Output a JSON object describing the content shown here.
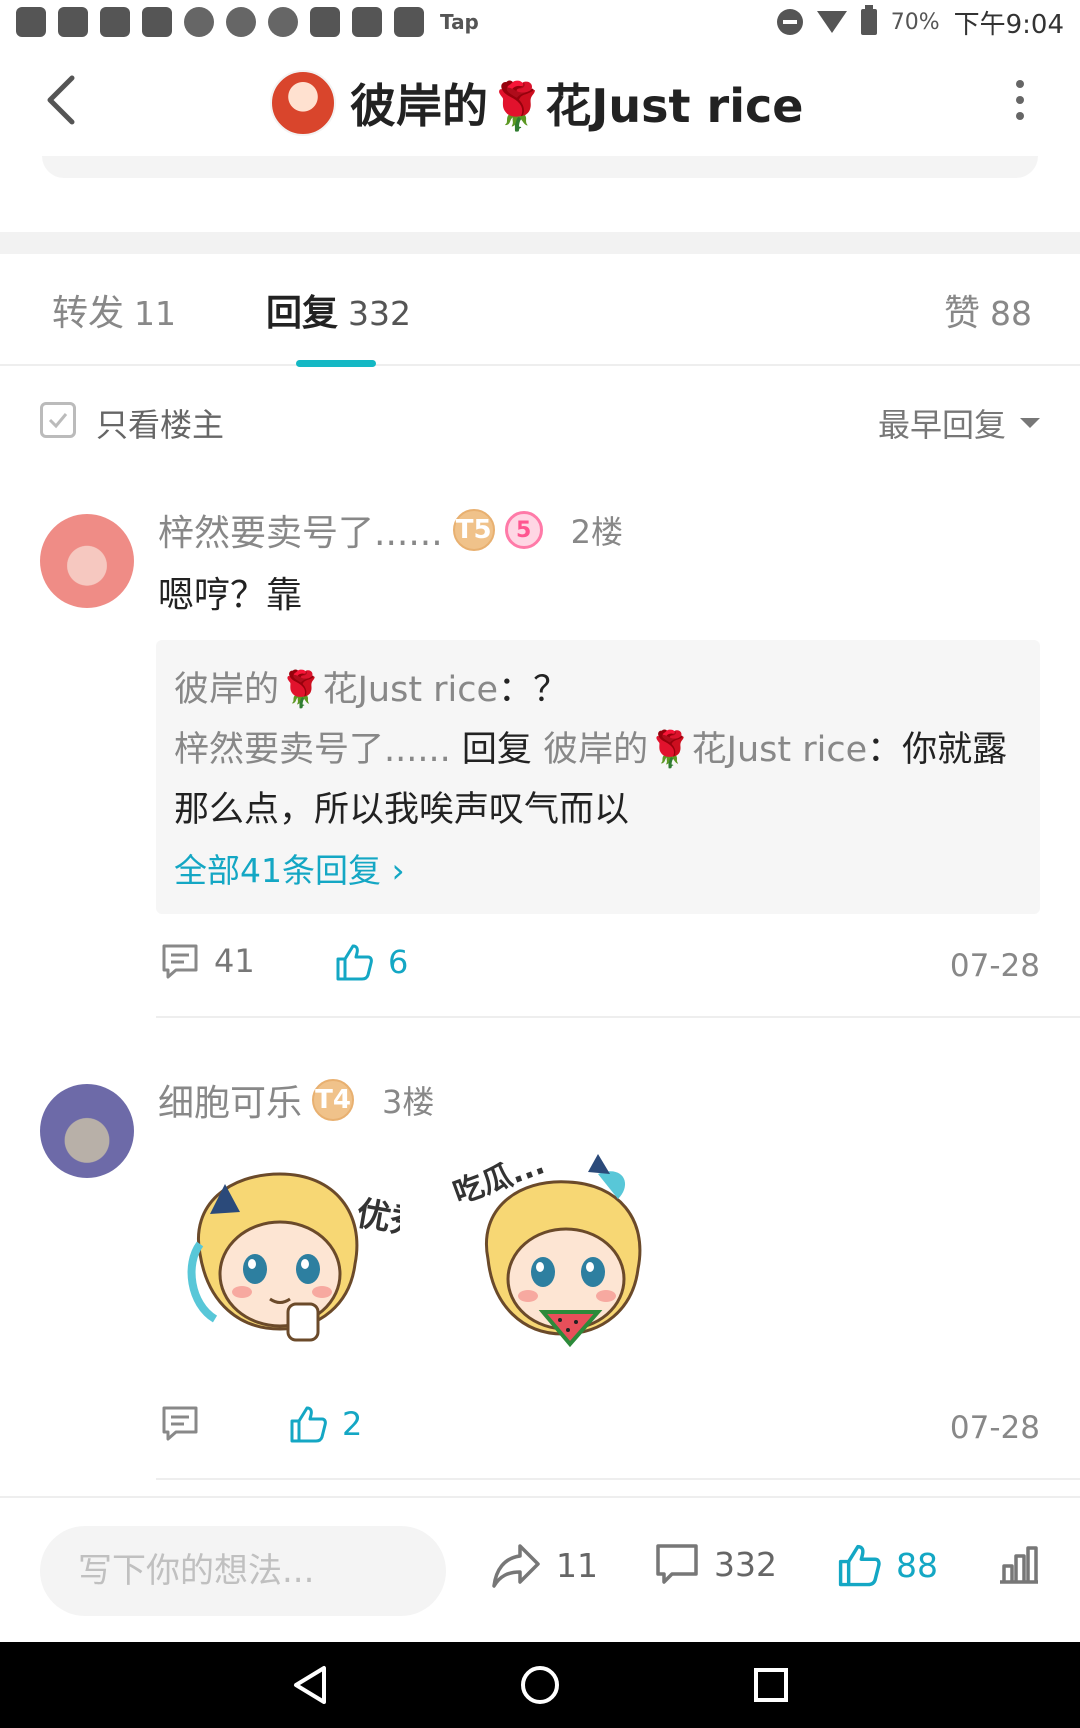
{
  "status_bar": {
    "tap_label": "Tap",
    "battery": "70%",
    "time": "下午9:04"
  },
  "header": {
    "title": "彼岸的🌹花Just rice"
  },
  "tabs": [
    {
      "label": "转发",
      "count": "11"
    },
    {
      "label": "回复",
      "count": "332"
    },
    {
      "label": "赞",
      "count": "88"
    }
  ],
  "filter": {
    "only_op_label": "只看楼主",
    "sort_label": "最早回复"
  },
  "comments": [
    {
      "username": "梓然要卖号了......",
      "badge": "T5",
      "badge2": "5",
      "floor": "2楼",
      "text": "嗯哼？靠",
      "replies": {
        "line1_user": "彼岸的🌹花Just rice",
        "line1_sep": "：",
        "line1_text": "？",
        "line2_user": "梓然要卖号了......",
        "line2_reply_word": "回复",
        "line2_target": "彼岸的🌹花Just rice",
        "line2_sep": "：",
        "line2_text": "你就露那么点，所以我唉声叹气而以",
        "more_label": "全部41条回复 ›"
      },
      "comment_count": "41",
      "like_count": "6",
      "date": "07-28"
    },
    {
      "username": "细胞可乐",
      "badge": "T4",
      "floor": "3楼",
      "stickers": [
        {
          "caption": "优秀"
        },
        {
          "caption": "吃瓜..."
        }
      ],
      "like_count": "2",
      "date": "07-28"
    }
  ],
  "bottom_bar": {
    "input_placeholder": "写下你的想法...",
    "share_count": "11",
    "comment_count": "332",
    "like_count": "88"
  },
  "colors": {
    "accent": "#14a7c4",
    "text_primary": "#222222",
    "text_secondary": "#888888"
  }
}
